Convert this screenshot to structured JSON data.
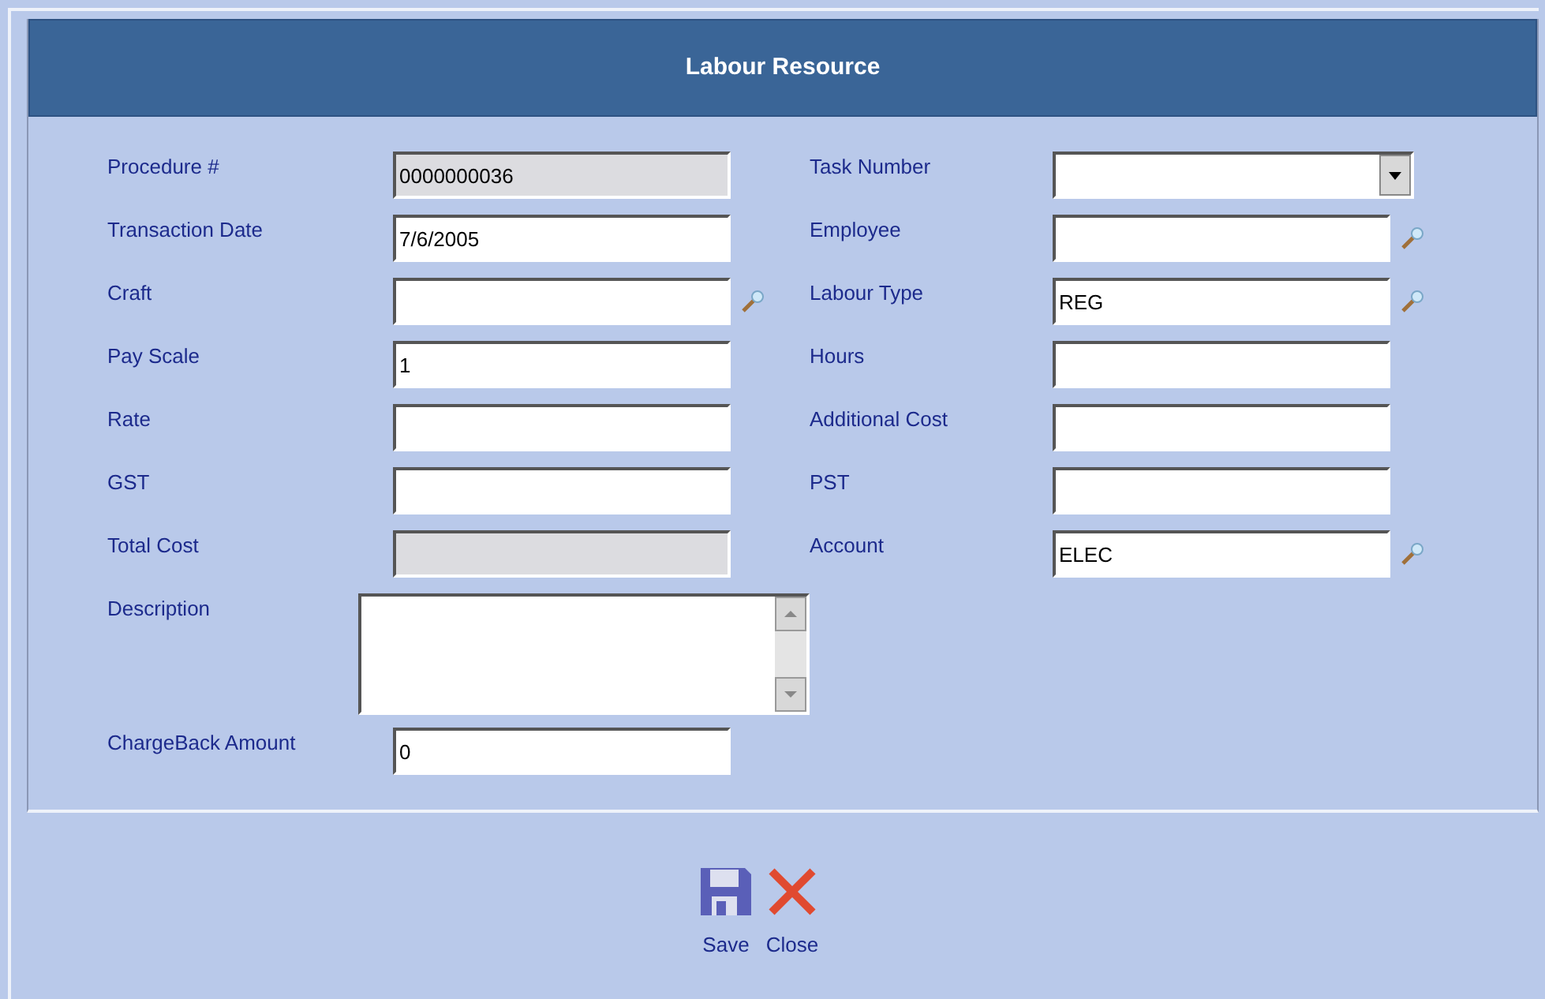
{
  "form": {
    "title": "Labour Resource",
    "left_fields": [
      {
        "label": "Procedure #",
        "kind": "text",
        "value": "0000000036",
        "disabled": true,
        "lookup": false
      },
      {
        "label": "Transaction Date",
        "kind": "text",
        "value": "7/6/2005",
        "disabled": false,
        "lookup": false
      },
      {
        "label": "Craft",
        "kind": "text",
        "disabled": false,
        "lookup": true
      },
      {
        "label": "Pay Scale",
        "kind": "text",
        "value": "1",
        "disabled": false,
        "lookup": false
      },
      {
        "label": "Rate",
        "kind": "text",
        "disabled": false,
        "lookup": false
      },
      {
        "label": "GST",
        "kind": "text",
        "disabled": false,
        "lookup": false
      },
      {
        "label": "Total Cost",
        "kind": "text",
        "disabled": true,
        "lookup": false
      },
      {
        "label": "Description",
        "kind": "textarea",
        "disabled": false,
        "lookup": false
      },
      {
        "label": "ChargeBack Amount",
        "kind": "text",
        "value": "0",
        "disabled": false,
        "lookup": false
      }
    ],
    "right_fields": [
      {
        "label": "Task Number",
        "kind": "select",
        "disabled": false,
        "lookup": false
      },
      {
        "label": "Employee",
        "kind": "text",
        "disabled": false,
        "lookup": true
      },
      {
        "label": "Labour Type",
        "kind": "text",
        "value": "REG",
        "disabled": false,
        "lookup": true
      },
      {
        "label": "Hours",
        "kind": "text",
        "disabled": false,
        "lookup": false
      },
      {
        "label": "Additional Cost",
        "kind": "text",
        "disabled": false,
        "lookup": false
      },
      {
        "label": "PST",
        "kind": "text",
        "disabled": false,
        "lookup": false
      },
      {
        "label": "Account",
        "kind": "text",
        "value": "ELEC",
        "disabled": false,
        "lookup": true
      }
    ]
  },
  "actions": [
    {
      "kind": "save",
      "label": "Save"
    },
    {
      "kind": "close",
      "label": "Close"
    }
  ]
}
